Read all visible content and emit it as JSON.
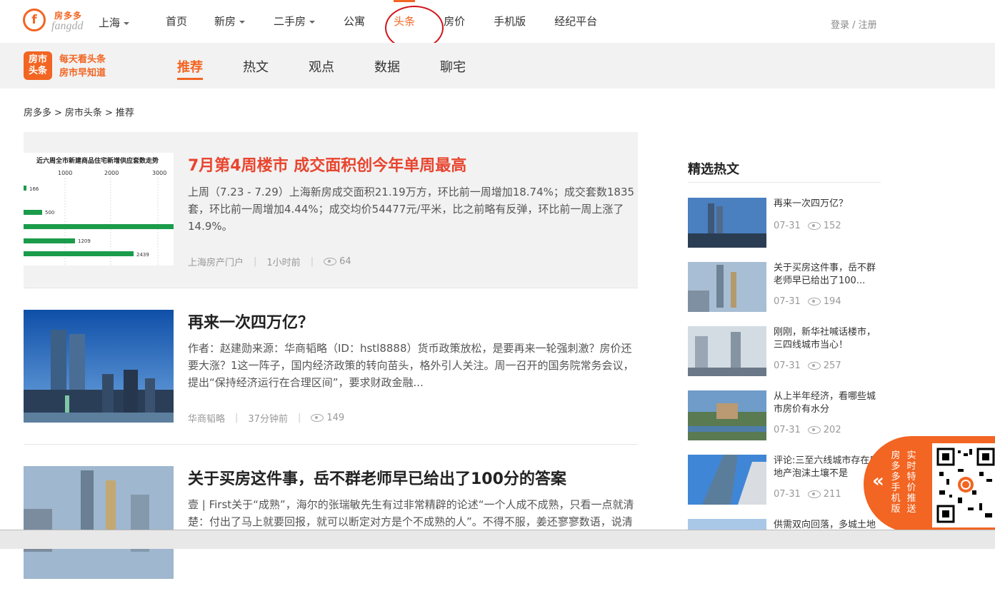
{
  "header": {
    "brand": "房多多",
    "brand_sub": "fangdd",
    "city": "上海",
    "nav": [
      {
        "label": "首页",
        "dropdown": false
      },
      {
        "label": "新房",
        "dropdown": true
      },
      {
        "label": "二手房",
        "dropdown": true
      },
      {
        "label": "公寓",
        "dropdown": false
      },
      {
        "label": "头条",
        "dropdown": false,
        "active": true
      },
      {
        "label": "房价",
        "dropdown": false
      },
      {
        "label": "手机版",
        "dropdown": false
      },
      {
        "label": "经纪平台",
        "dropdown": false
      }
    ],
    "login": "登录 / 注册"
  },
  "subnav": {
    "logo_line1": "房市",
    "logo_line2": "头条",
    "slogan1": "每天看头条",
    "slogan2": "房市早知道",
    "tabs": [
      "推荐",
      "热文",
      "观点",
      "数据",
      "聊宅"
    ],
    "active_tab": "推荐"
  },
  "breadcrumb": [
    "房多多",
    ">",
    "房市头条",
    ">",
    "推荐"
  ],
  "articles": [
    {
      "title": "7月第4周楼市 成交面积创今年单周最高",
      "desc": "上周（7.23 - 7.29）上海新房成交面积21.19万方，环比前一周增加18.74%；成交套数1835套，环比前一周增加4.44%；成交均价54477元/平米，比之前略有反弹，环比前一周上涨了14.9%。",
      "source": "上海房产门户",
      "time": "1小时前",
      "views": "64",
      "thumb_chart": {
        "title": "近六周全市新建商品住宅新增供应套数走势",
        "ticks": [
          "1000",
          "2000",
          "3000"
        ],
        "values": [
          "166",
          "500",
          "1209",
          "2439"
        ]
      }
    },
    {
      "title": "再来一次四万亿？",
      "desc": "作者：赵建勋来源：华商韬略（ID：hstl8888）货币政策放松，是要再来一轮强刺激？房价还要大涨？1这一阵子，国内经济政策的转向苗头，格外引人关注。周一召开的国务院常务会议，提出“保持经济运行在合理区间”，要求财政金融...",
      "source": "华商韬略",
      "time": "37分钟前",
      "views": "149"
    },
    {
      "title": "关于买房这件事，岳不群老师早已给出了100分的答案",
      "desc": "壹 | First关于“成熟”，海尔的张瑞敏先生有过非常精辟的论述“一个人成不成熟，只看一点就清楚：付出了马上就要回报，就可以断定对方是个不成熟的人”。不得不服，姜还寥寥数语，说清楚了很多人百思不得其解的疑问。这也..."
    }
  ],
  "sidebar": {
    "title": "精选热文",
    "items": [
      {
        "title": "再来一次四万亿？",
        "date": "07-31",
        "views": "152"
      },
      {
        "title": "关于买房这件事，岳不群老师早已给出了100...",
        "date": "07-31",
        "views": "194"
      },
      {
        "title": "刚刚，新华社喊话楼市，三四线城市当心！",
        "date": "07-31",
        "views": "257"
      },
      {
        "title": "从上半年经济，看哪些城市房价有水分",
        "date": "07-31",
        "views": "202"
      },
      {
        "title": "评论:三至六线城市存在房地产泡沫土壤不是",
        "date": "07-31",
        "views": "211"
      },
      {
        "title": "供需双向回落，多城土地流拍",
        "date": "",
        "views": ""
      }
    ]
  },
  "float_widget": {
    "arrow": "«",
    "col1": "房多多手机版",
    "col2": "实时特价推送"
  },
  "colors": {
    "accent": "#f26522",
    "title_red": "#e8452f",
    "circle": "#d0131a"
  }
}
